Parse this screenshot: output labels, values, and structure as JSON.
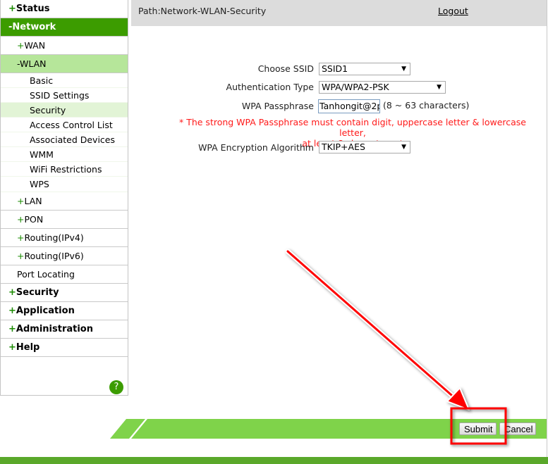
{
  "sidebar": {
    "items": [
      {
        "prefix": "+",
        "label": "Status"
      },
      {
        "prefix": "-",
        "label": "Network"
      },
      {
        "prefix": "+",
        "label": "WAN"
      },
      {
        "prefix": "-",
        "label": "WLAN"
      },
      {
        "label": "Basic"
      },
      {
        "label": "SSID Settings"
      },
      {
        "label": "Security"
      },
      {
        "label": "Access Control List"
      },
      {
        "label": "Associated Devices"
      },
      {
        "label": "WMM"
      },
      {
        "label": "WiFi Restrictions"
      },
      {
        "label": "WPS"
      },
      {
        "prefix": "+",
        "label": "LAN"
      },
      {
        "prefix": "+",
        "label": "PON"
      },
      {
        "prefix": "+",
        "label": "Routing(IPv4)"
      },
      {
        "prefix": "+",
        "label": "Routing(IPv6)"
      },
      {
        "prefix": "",
        "label": "Port Locating"
      },
      {
        "prefix": "+",
        "label": "Security"
      },
      {
        "prefix": "+",
        "label": "Application"
      },
      {
        "prefix": "+",
        "label": "Administration"
      },
      {
        "prefix": "+",
        "label": "Help"
      }
    ],
    "help_icon": "?"
  },
  "header": {
    "path": "Path:Network-WLAN-Security",
    "logout": "Logout"
  },
  "form": {
    "ssid": {
      "label": "Choose SSID",
      "value": "SSID1"
    },
    "auth": {
      "label": "Authentication Type",
      "value": "WPA/WPA2-PSK"
    },
    "passphrase": {
      "label": "WPA Passphrase",
      "value": "Tanhongit@2p",
      "hint": "(8 ~ 63 characters)"
    },
    "warning_line1": "* The strong WPA Passphrase must contain digit, uppercase letter & lowercase letter,",
    "warning_line2": "at least 8 characters. *",
    "encryption": {
      "label": "WPA Encryption Algorithm",
      "value": "TKIP+AES"
    }
  },
  "buttons": {
    "submit": "Submit",
    "cancel": "Cancel"
  },
  "colors": {
    "brand_green": "#3c9c00",
    "footer_green": "#7fd34a",
    "warning_red": "#ff1a1a",
    "annotation_red": "#ff0000"
  }
}
